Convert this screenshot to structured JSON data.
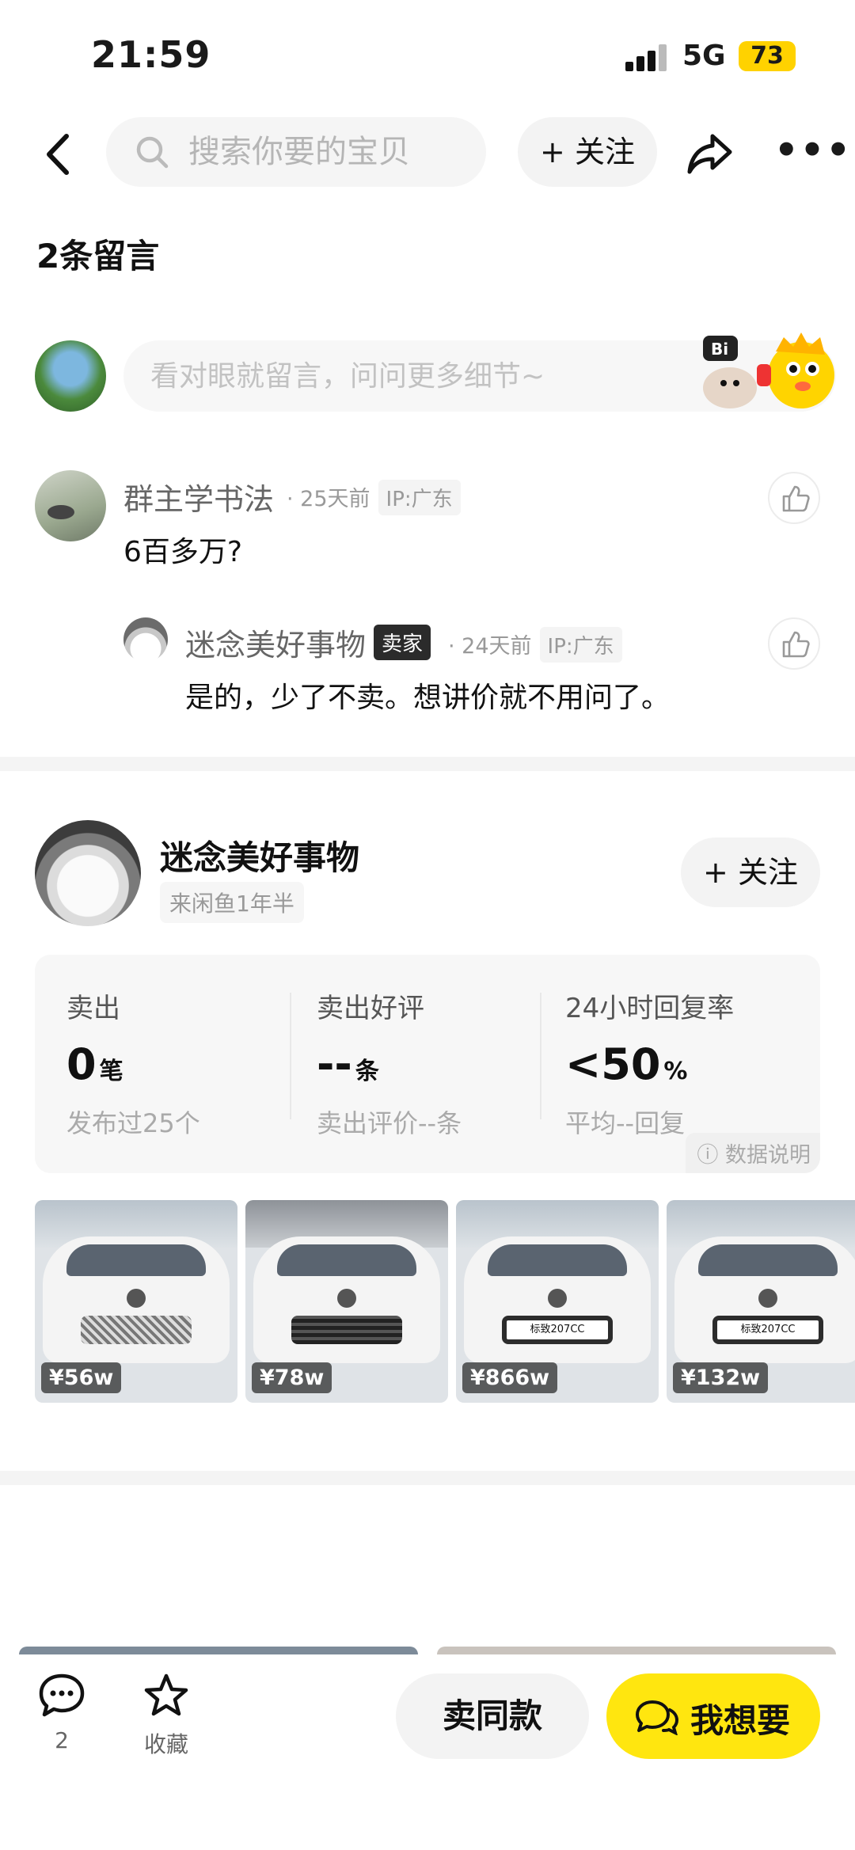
{
  "status_bar": {
    "time": "21:59",
    "network": "5G",
    "battery": "73"
  },
  "nav": {
    "search_placeholder": "搜索你要的宝贝",
    "follow_label": "+ 关注"
  },
  "comments": {
    "count_label": "2条留言",
    "input_placeholder": "看对眼就留言，问问更多细节~",
    "items": [
      {
        "name": "群主学书法",
        "time": "· 25天前",
        "ip": "IP:广东",
        "text": "6百多万?"
      },
      {
        "name": "迷念美好事物",
        "tag": "卖家",
        "time": "· 24天前",
        "ip": "IP:广东",
        "text": "是的，少了不卖。想讲价就不用问了。"
      }
    ]
  },
  "seller": {
    "name": "迷念美好事物",
    "years": "来闲鱼1年半",
    "follow_label": "+ 关注",
    "stats": [
      {
        "label": "卖出",
        "value": "0",
        "unit": "笔",
        "sub": "发布过25个"
      },
      {
        "label": "卖出好评",
        "value": "--",
        "unit": "条",
        "sub": "卖出评价--条"
      },
      {
        "label": "24小时回复率",
        "value": "<50",
        "unit": "%",
        "sub": "平均--回复"
      }
    ],
    "data_note": "数据说明"
  },
  "products": [
    {
      "price": "¥56w",
      "plate": ""
    },
    {
      "price": "¥78w",
      "plate": ""
    },
    {
      "price": "¥866w",
      "plate": "标致207CC"
    },
    {
      "price": "¥132w",
      "plate": "标致207CC"
    }
  ],
  "bottom_bar": {
    "comment_count": "2",
    "favorite_label": "收藏",
    "sell_same_label": "卖同款",
    "want_label": "我想要"
  },
  "colors": {
    "accent": "#ffe60f",
    "battery": "#ffd200",
    "divider": "#f4f4f4"
  }
}
